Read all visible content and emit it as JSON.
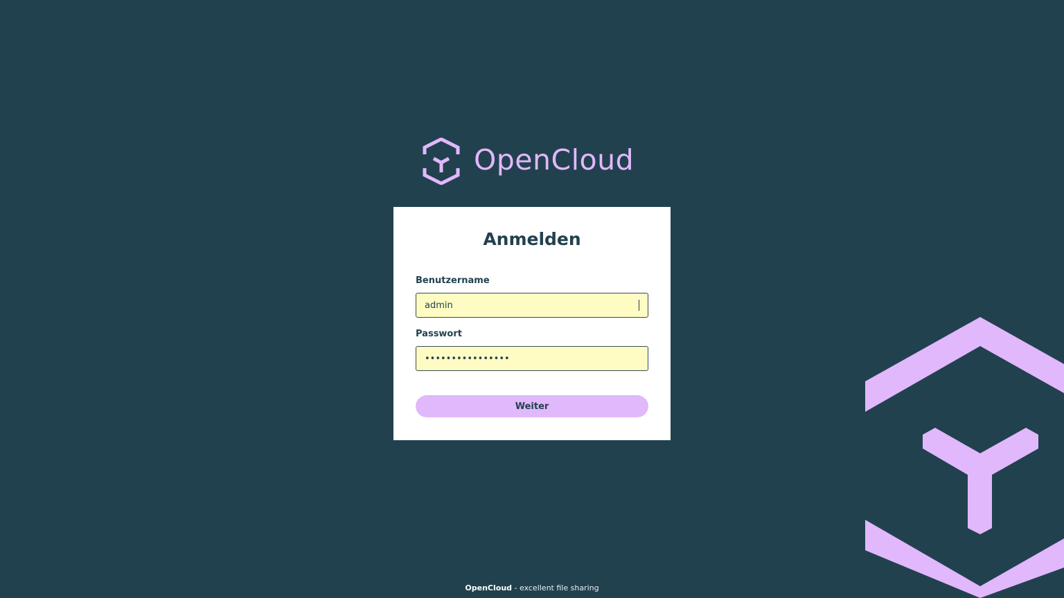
{
  "brand": {
    "name": "OpenCloud",
    "logo_icon": "opencloud-hexagon-icon",
    "accent_color": "#e1b8fb"
  },
  "login": {
    "title": "Anmelden",
    "username_label": "Benutzername",
    "username_value": "admin",
    "password_label": "Passwort",
    "password_value": "••••••••••••••••",
    "submit_label": "Weiter"
  },
  "footer": {
    "brand": "OpenCloud",
    "tagline": " - excellent file sharing"
  },
  "colors": {
    "background": "#22414f",
    "card": "#ffffff",
    "input_autofill": "#fefcc2"
  }
}
